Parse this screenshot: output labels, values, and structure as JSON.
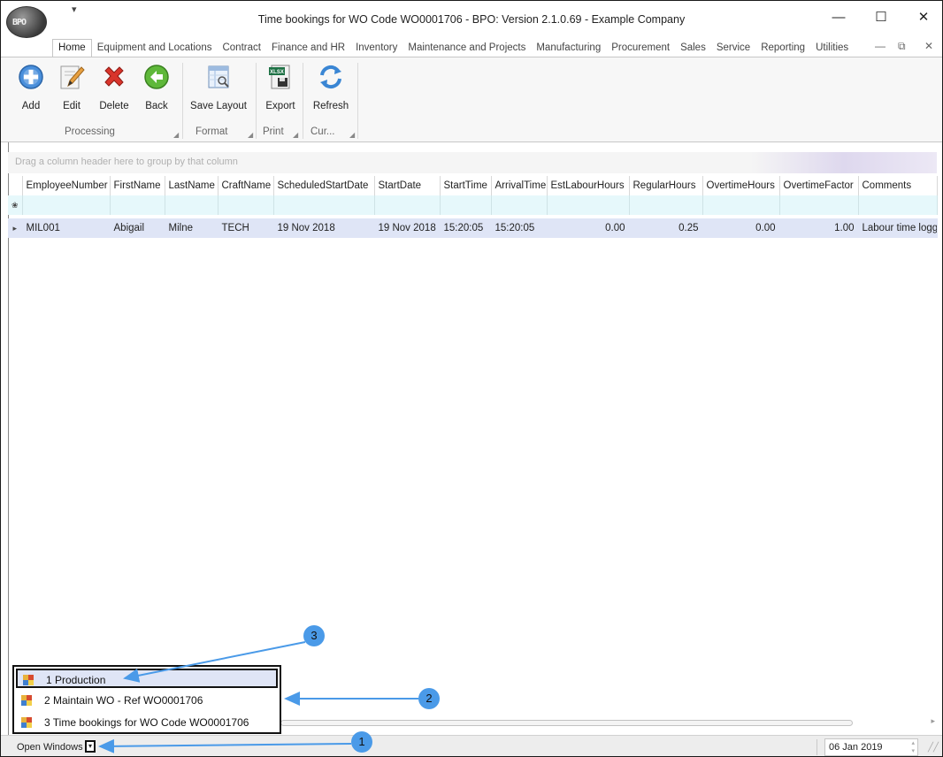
{
  "window": {
    "title": "Time bookings for WO Code WO0001706 - BPO: Version 2.1.0.69 - Example Company",
    "logo_text": "BPO",
    "qat_glyph": "▾",
    "controls": {
      "minimize": "—",
      "maximize": "☐",
      "close": "✕"
    }
  },
  "ribbon": {
    "tabs": [
      "Home",
      "Equipment and Locations",
      "Contract",
      "Finance and HR",
      "Inventory",
      "Maintenance and Projects",
      "Manufacturing",
      "Procurement",
      "Sales",
      "Service",
      "Reporting",
      "Utilities"
    ],
    "mdi_controls": {
      "minimize": "—",
      "restore": "⧉",
      "close": "✕"
    },
    "buttons": {
      "add": "Add",
      "edit": "Edit",
      "delete": "Delete",
      "back": "Back",
      "save_layout": "Save Layout",
      "export": "Export",
      "refresh": "Refresh"
    },
    "groups": {
      "processing": "Processing",
      "format": "Format",
      "print": "Print",
      "current": "Cur..."
    },
    "export_icon_text": "XLSX",
    "launcher_glyph": "◢"
  },
  "grid": {
    "group_panel_hint": "Drag a column header here to group by that column",
    "columns": [
      "EmployeeNumber",
      "FirstName",
      "LastName",
      "CraftName",
      "ScheduledStartDate",
      "StartDate",
      "StartTime",
      "ArrivalTime",
      "EstLabourHours",
      "RegularHours",
      "OvertimeHours",
      "OvertimeFactor",
      "Comments"
    ],
    "filter_glyph": "❀",
    "row_indicator": "▸",
    "rows": [
      {
        "EmployeeNumber": "MIL001",
        "FirstName": "Abigail",
        "LastName": "Milne",
        "CraftName": "TECH",
        "ScheduledStartDate": "19 Nov 2018",
        "StartDate": "19 Nov 2018",
        "StartTime": "15:20:05",
        "ArrivalTime": "15:20:05",
        "EstLabourHours": "0.00",
        "RegularHours": "0.25",
        "OvertimeHours": "0.00",
        "OvertimeFactor": "1.00",
        "Comments": "Labour time logged"
      }
    ]
  },
  "open_windows_menu": {
    "items": [
      {
        "label": "1 Production",
        "highlighted": true
      },
      {
        "label": "2 Maintain WO - Ref WO0001706",
        "highlighted": false
      },
      {
        "label": "3 Time bookings for WO Code WO0001706",
        "highlighted": false
      }
    ]
  },
  "statusbar": {
    "open_windows": "Open Windows",
    "dropdown_glyph": "▾",
    "date": "06 Jan 2019",
    "spin_glyph": "▴\n▾",
    "grip": "╱╱",
    "scroll_arrow": "▸"
  },
  "callouts": [
    "1",
    "2",
    "3"
  ],
  "colors": {
    "accent": "#4a9ae8",
    "row_selected": "#dfe5f6",
    "filter_row": "#e6f8fb"
  }
}
